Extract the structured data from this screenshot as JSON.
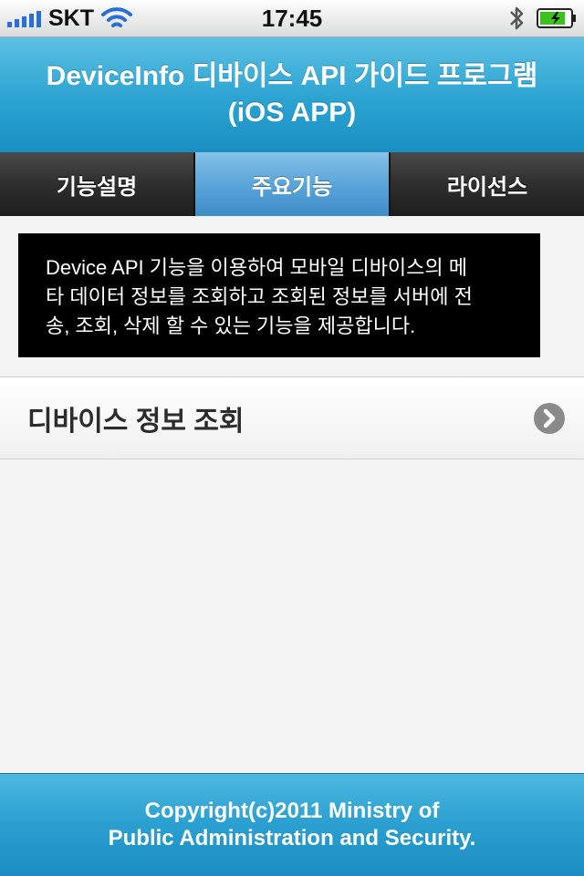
{
  "status_bar": {
    "carrier": "SKT",
    "time": "17:45",
    "signal_bars": 5,
    "battery_level": 0.85,
    "icons": [
      "signal-icon",
      "wifi-icon",
      "bluetooth-icon",
      "battery-icon"
    ]
  },
  "header": {
    "title": "DeviceInfo 디바이스 API 가이드 프로그램 (iOS APP)"
  },
  "tabs": [
    {
      "label": "기능설명",
      "active": false
    },
    {
      "label": "주요기능",
      "active": true
    },
    {
      "label": "라이선스",
      "active": false
    }
  ],
  "description": {
    "lines": [
      "Device API 기능을 이용하여 모바일 디바이스의 메",
      "타 데이터 정보를 조회하고 조회된 정보를 서버에 전",
      "송, 조회, 삭제 할 수 있는 기능을 제공합니다."
    ]
  },
  "list": {
    "items": [
      {
        "label": "디바이스 정보 조회",
        "icon": "chevron-right-icon"
      }
    ]
  },
  "footer": {
    "lines": [
      "Copyright(c)2011 Ministry of",
      "Public Administration and Security."
    ]
  },
  "colors": {
    "header_blue": "#2aa3d2",
    "tab_active": "#5aa5d9",
    "tab_inactive": "#2e2e2e",
    "description_bg": "#000000"
  }
}
